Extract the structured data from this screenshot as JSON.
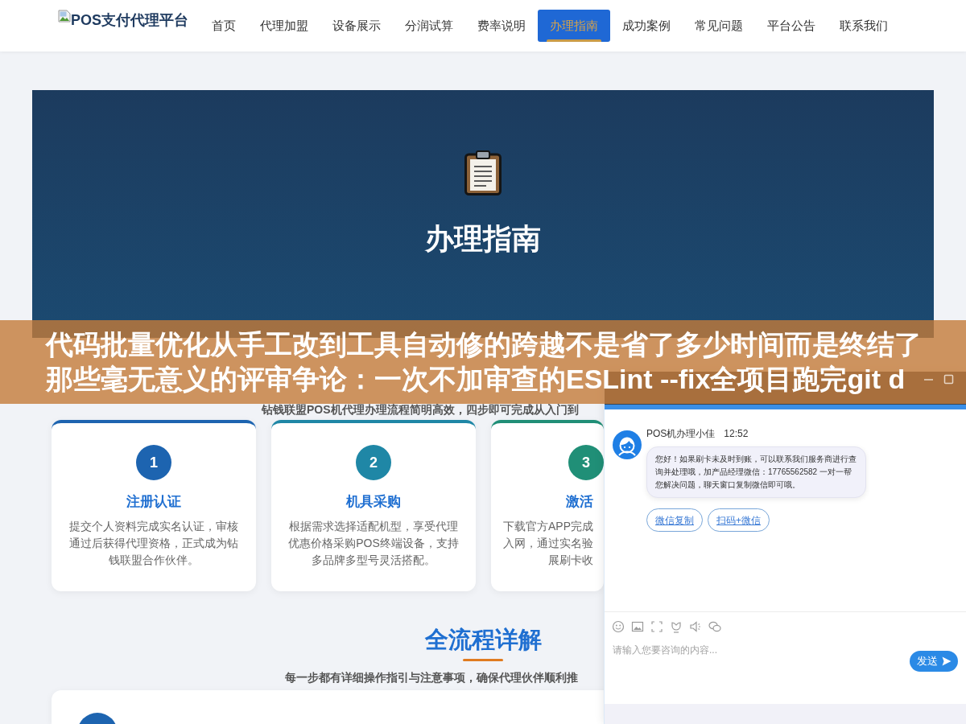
{
  "header": {
    "logo_text": "POS支付代理平台",
    "nav": [
      {
        "label": "首页",
        "selected": false
      },
      {
        "label": "代理加盟",
        "selected": false
      },
      {
        "label": "设备展示",
        "selected": false
      },
      {
        "label": "分润试算",
        "selected": false
      },
      {
        "label": "费率说明",
        "selected": false
      },
      {
        "label": "办理指南",
        "selected": true
      },
      {
        "label": "成功案例",
        "selected": false
      },
      {
        "label": "常见问题",
        "selected": false
      },
      {
        "label": "平台公告",
        "selected": false
      },
      {
        "label": "联系我们",
        "selected": false
      }
    ]
  },
  "hero": {
    "title": "办理指南"
  },
  "banner": {
    "text": "代码批量优化从手工改到工具自动修的跨越不是省了多少时间而是终结了那些毫无意义的评审争论：一次不加审查的ESLint --fix全项目跑完git d"
  },
  "steps_section": {
    "subtitle": "钻钱联盟POS机代理办理流程简明高效，四步即可完成从入门到",
    "cards": [
      {
        "kind": "full",
        "number": "1",
        "title": "注册认证",
        "description": "提交个人资料完成实名认证，审核通过后获得代理资格，正式成为钻钱联盟合作伙伴。",
        "color": "#1d64b0"
      },
      {
        "kind": "full",
        "number": "2",
        "title": "机具采购",
        "description": "根据需求选择适配机型，享受代理优惠价格采购POS终端设备，支持多品牌多型号灵活搭配。",
        "color": "#1f87a6"
      },
      {
        "kind": "partial",
        "number": "3",
        "title": "激活",
        "description": "下载官方APP完成入网，通过实名验展刷卡收",
        "color": "#208f77"
      }
    ]
  },
  "process_section": {
    "title": "全流程详解",
    "subtitle": "每一步都有详细操作指引与注意事项，确保代理伙伴顺利推"
  },
  "chat_window": {
    "sender": "POS机办理小佳",
    "time": "12:52",
    "message": "您好！如果刷卡未及时到账，可以联系我们服务商进行查询并处理哦，加产品经理微信：17765562582 一对一帮您解决问题，聊天窗口复制微信即可哦。",
    "actions": [
      "微信复制",
      "扫码+微信"
    ],
    "input": {
      "placeholder": "请输入您要咨询的内容..."
    },
    "send_label": "发送"
  }
}
